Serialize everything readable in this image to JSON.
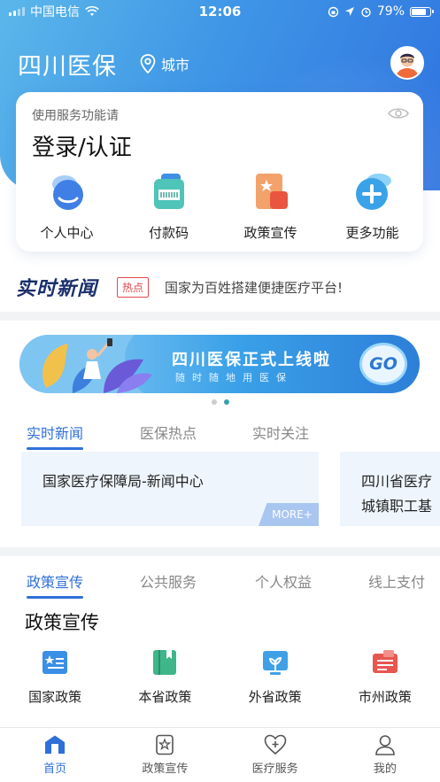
{
  "status_bar": {
    "carrier": "中国电信",
    "time": "12:06",
    "battery": "79%"
  },
  "header": {
    "title": "四川医保",
    "city": "城市"
  },
  "login_card": {
    "hint": "使用服务功能请",
    "title": "登录/认证",
    "quick_actions": [
      {
        "label": "个人中心",
        "icon": "person-icon"
      },
      {
        "label": "付款码",
        "icon": "payment-code-icon"
      },
      {
        "label": "政策宣传",
        "icon": "policy-promo-icon"
      },
      {
        "label": "更多功能",
        "icon": "plus-icon"
      }
    ]
  },
  "news_ticker": {
    "logo": "实时新闻",
    "tag": "热点",
    "text": "国家为百姓搭建便捷医疗平台!"
  },
  "banner": {
    "title": "四川医保正式上线啦",
    "subtitle": "随时随地用医保",
    "go": "GO",
    "slide_count": 2,
    "active_slide": 2
  },
  "news_tabs": [
    {
      "label": "实时新闻",
      "active": true
    },
    {
      "label": "医保热点",
      "active": false
    },
    {
      "label": "实时关注",
      "active": false
    }
  ],
  "news_cards": [
    {
      "title": "国家医疗保障局-新闻中心",
      "more": "MORE+"
    },
    {
      "title": "四川省医疗",
      "line2": "城镇职工基"
    }
  ],
  "service_tabs": [
    {
      "label": "政策宣传",
      "active": true
    },
    {
      "label": "公共服务",
      "active": false
    },
    {
      "label": "个人权益",
      "active": false
    },
    {
      "label": "线上支付",
      "active": false
    }
  ],
  "policy_section": {
    "title": "政策宣传",
    "items": [
      {
        "label": "国家政策",
        "icon": "national-policy-icon",
        "color": "#3b8fe6"
      },
      {
        "label": "本省政策",
        "icon": "provincial-policy-icon",
        "color": "#3fb58a"
      },
      {
        "label": "外省政策",
        "icon": "other-province-policy-icon",
        "color": "#3fa0e6"
      },
      {
        "label": "市州政策",
        "icon": "city-policy-icon",
        "color": "#e8574f"
      }
    ]
  },
  "bottom_nav": [
    {
      "label": "首页",
      "icon": "home-icon",
      "active": true
    },
    {
      "label": "政策宣传",
      "icon": "star-icon",
      "active": false
    },
    {
      "label": "医疗服务",
      "icon": "heart-plus-icon",
      "active": false
    },
    {
      "label": "我的",
      "icon": "user-icon",
      "active": false
    }
  ],
  "colors": {
    "accent": "#2f70d8",
    "hero_start": "#5bb7ea",
    "hero_end": "#2f73e0",
    "hot": "#e0484c"
  }
}
